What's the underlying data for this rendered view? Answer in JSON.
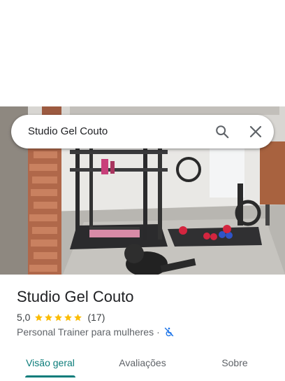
{
  "search": {
    "query": "Studio Gel Couto",
    "search_icon": "search-icon",
    "close_icon": "close-icon"
  },
  "photo": {
    "subject": "gym interior",
    "icon": "gym-photo"
  },
  "place": {
    "name": "Studio Gel Couto",
    "rating": "5,0",
    "stars": 5,
    "review_count": "(17)",
    "category": "Personal Trainer para mulheres",
    "separator": "·",
    "accessibility_icon": "no-wheelchair-icon"
  },
  "tabs": [
    {
      "label": "Visão geral",
      "active": true
    },
    {
      "label": "Avaliações",
      "active": false
    },
    {
      "label": "Sobre",
      "active": false
    }
  ],
  "colors": {
    "accent": "#0b7c7a",
    "star": "#fbbc04",
    "text_primary": "#202124",
    "text_secondary": "#5f6368",
    "accessibility_icon": "#1a73e8"
  }
}
